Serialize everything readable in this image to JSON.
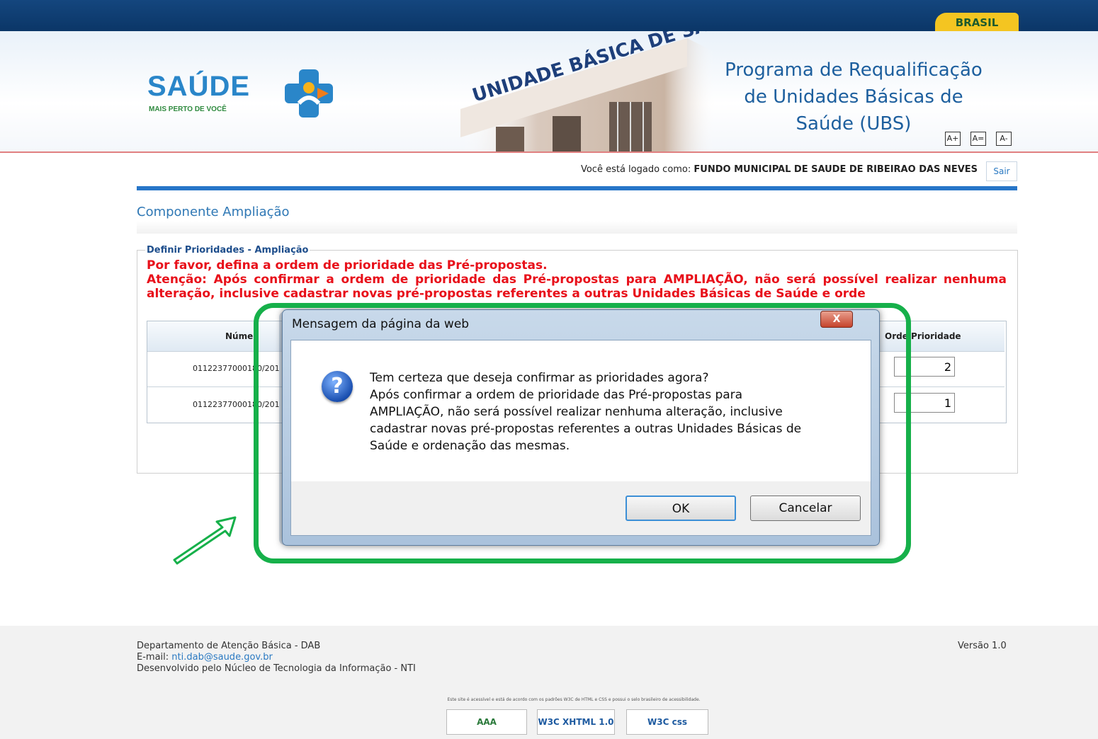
{
  "gov_bar": {
    "brasil_label": "BRASIL"
  },
  "header": {
    "logo_text": "SAÚDE",
    "logo_sub": "MAIS PERTO DE VOCÊ",
    "sign_text": "UNIDADE BÁSICA DE SAÚDE",
    "program_title_l1": "Programa de Requalificação",
    "program_title_l2": "de Unidades Básicas de",
    "program_title_l3": "Saúde (UBS)",
    "font_buttons": [
      "A+",
      "A=",
      "A-"
    ]
  },
  "login": {
    "prefix": "Você está logado como:",
    "user": "FUNDO MUNICIPAL DE SAUDE DE RIBEIRAO DAS NEVES",
    "logout_label": "Sair"
  },
  "page": {
    "component_title": "Componente Ampliação",
    "legend": "Definir Prioridades - Ampliação",
    "warning_1": "Por favor, defina a ordem de prioridade das Pré-propostas.",
    "warning_2": "Atenção: Após confirmar a ordem de prioridade das Pré-propostas para AMPLIAÇÃO, não será possível realizar nenhuma alteração, inclusive cadastrar novas pré-propostas referentes a outras Unidades Básicas de Saúde e orde"
  },
  "table": {
    "col_number": "Núme",
    "col_priority": "Orde   Prioridade",
    "rows": [
      {
        "number": "01122377000180/201",
        "priority": "2"
      },
      {
        "number": "01122377000180/201",
        "priority": "1"
      }
    ]
  },
  "dialog": {
    "title": "Mensagem da página da web",
    "close_label": "X",
    "icon": "question-icon",
    "message_l1": "Tem certeza que deseja confirmar as prioridades agora?",
    "message_l2": "Após confirmar a ordem de prioridade das Pré-propostas para",
    "message_l3": "AMPLIAÇÃO, não será possível realizar nenhuma alteração, inclusive",
    "message_l4": "cadastrar novas pré-propostas referentes a outras Unidades Básicas de",
    "message_l5": "Saúde e ordenação das mesmas.",
    "ok_label": "OK",
    "cancel_label": "Cancelar"
  },
  "footer": {
    "line1": "Departamento de Atenção Básica - DAB",
    "email_prefix": "E-mail: ",
    "email": "nti.dab@saude.gov.br",
    "line3": "Desenvolvido pelo Núcleo de Tecnologia da Informação - NTI",
    "version": "Versão 1.0",
    "accessibility_note": "Este site é acessível e está de acordo com os padrões W3C de HTML e CSS e possui o selo brasileiro de acessibilidade.",
    "badges": [
      "AAA",
      "W3C XHTML 1.0",
      "W3C css"
    ]
  },
  "colors": {
    "highlight": "#16b04a",
    "warning": "#e8101a",
    "brand_blue": "#2776c8"
  }
}
